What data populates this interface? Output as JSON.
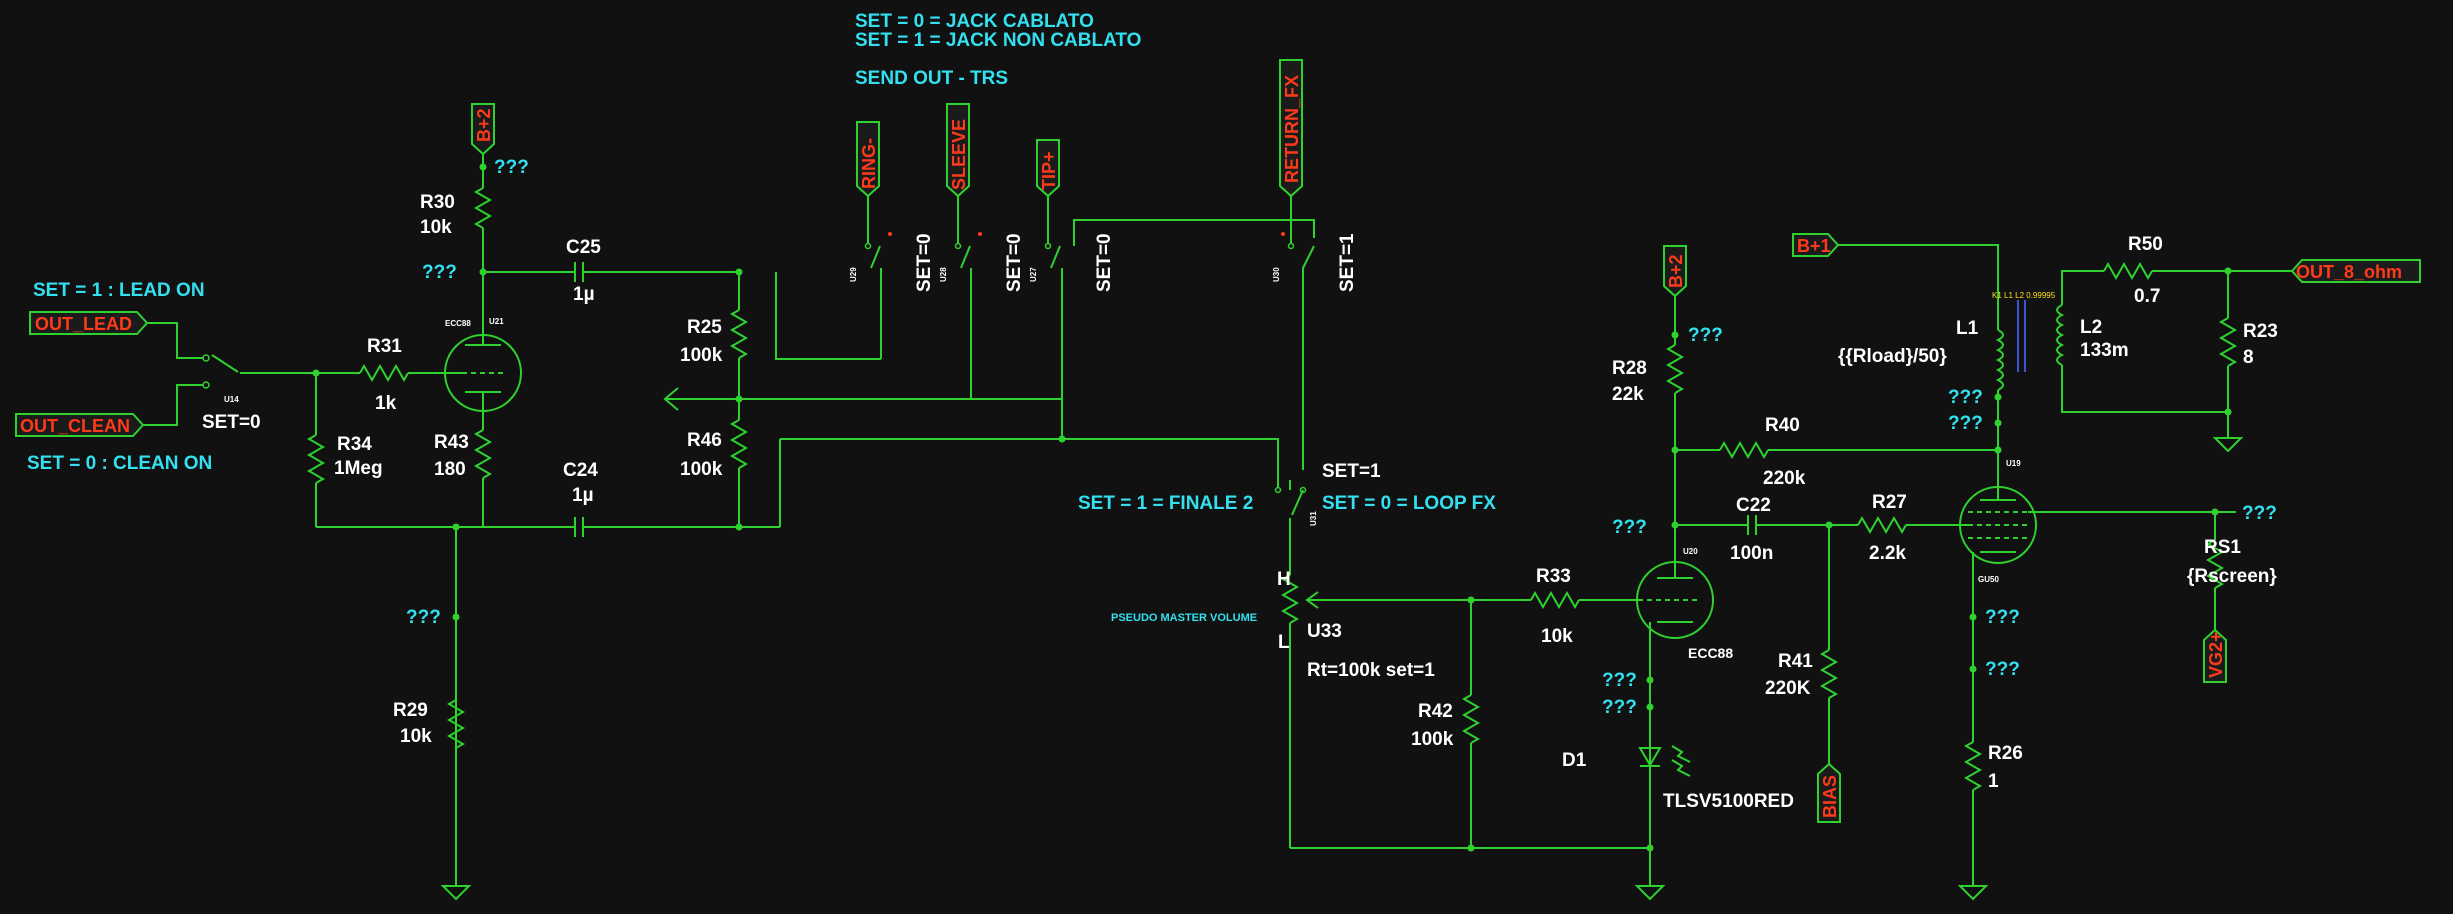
{
  "notes": {
    "set0_jack": "SET = 0 = JACK CABLATO",
    "set1_jack": "SET = 1 = JACK NON CABLATO",
    "send_out": "SEND OUT - TRS",
    "lead_on": "SET = 1 : LEAD ON",
    "clean_on": "SET = 0 : CLEAN ON",
    "finale2": "SET = 1 = FINALE 2",
    "loopfx": "SET = 0 = LOOP FX",
    "pseudo_master": "PSEUDO MASTER VOLUME"
  },
  "nets": {
    "b2_top": "B+2",
    "b2_right": "B+2",
    "b1": "B+1",
    "out_lead": "OUT_LEAD",
    "out_clean": "OUT_CLEAN",
    "ring": "RING-",
    "sleeve": "SLEEVE",
    "tip": "TIP+",
    "return_fx": "RETURN_FX",
    "out_8": "OUT_8_ohm",
    "bias": "BIAS",
    "vg2": "VG2+",
    "unknown": "???"
  },
  "components": {
    "R30": {
      "ref": "R30",
      "val": "10k"
    },
    "C25": {
      "ref": "C25",
      "val": "1µ"
    },
    "R25": {
      "ref": "R25",
      "val": "100k"
    },
    "R46": {
      "ref": "R46",
      "val": "100k"
    },
    "C24": {
      "ref": "C24",
      "val": "1µ"
    },
    "R43": {
      "ref": "R43",
      "val": "180"
    },
    "R31": {
      "ref": "R31",
      "val": "1k"
    },
    "R34": {
      "ref": "R34",
      "val": "1Meg"
    },
    "R29": {
      "ref": "R29",
      "val": "10k"
    },
    "R28": {
      "ref": "R28",
      "val": "22k"
    },
    "R40": {
      "ref": "R40",
      "val": "220k"
    },
    "C22": {
      "ref": "C22",
      "val": "100n"
    },
    "R27": {
      "ref": "R27",
      "val": "2.2k"
    },
    "R33": {
      "ref": "R33",
      "val": "10k"
    },
    "R42": {
      "ref": "R42",
      "val": "100k"
    },
    "R41": {
      "ref": "R41",
      "val": "220K"
    },
    "R26": {
      "ref": "R26",
      "val": "1"
    },
    "R50": {
      "ref": "R50",
      "val": "0.7"
    },
    "R23": {
      "ref": "R23",
      "val": "8"
    },
    "L1": {
      "ref": "L1",
      "val": "{{Rload}/50}"
    },
    "L2": {
      "ref": "L2",
      "val": "133m"
    },
    "RS1": {
      "ref": "RS1",
      "val": "{Rscreen}"
    },
    "D1": {
      "ref": "D1",
      "val": "TLSV5100RED"
    },
    "U33": {
      "ref": "U33",
      "val": "Rt=100k set=1",
      "h": "H",
      "l": "L"
    },
    "K1": "K1 L1 L2 0.99995",
    "U21": "U21",
    "U21_type": "ECC88",
    "U20": "U20",
    "U20_type": "ECC88",
    "U19": "U19",
    "U19_type": "GU50",
    "U14": "U14",
    "U29": "U29",
    "U28": "U28",
    "U27": "U27",
    "U30": "U30",
    "U31": "U31"
  },
  "switches": {
    "u14_set": "SET=0",
    "u29_set": "SET=0",
    "u28_set": "SET=0",
    "u27_set": "SET=0",
    "u30_set": "SET=1",
    "u31_set": "SET=1"
  }
}
